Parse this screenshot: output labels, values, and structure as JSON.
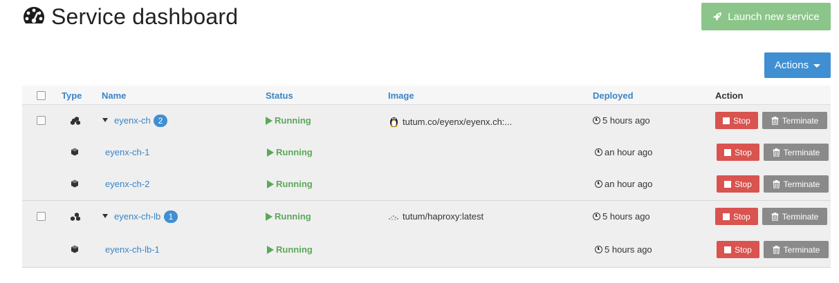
{
  "page": {
    "title": "Service dashboard",
    "launch_label": "Launch new service",
    "actions_label": "Actions"
  },
  "columns": {
    "type": "Type",
    "name": "Name",
    "status": "Status",
    "image": "Image",
    "deployed": "Deployed",
    "action": "Action"
  },
  "groups": [
    {
      "service": {
        "name": "eyenx-ch",
        "badge": "2",
        "status": "Running",
        "image": "tutum.co/eyenx/eyenx.ch:...",
        "image_icon": "linux-tux-icon",
        "deployed": "5 hours ago",
        "stop_label": "Stop",
        "terminate_label": "Terminate"
      },
      "containers": [
        {
          "name": "eyenx-ch-1",
          "status": "Running",
          "deployed": "an hour ago",
          "stop_label": "Stop",
          "terminate_label": "Terminate"
        },
        {
          "name": "eyenx-ch-2",
          "status": "Running",
          "deployed": "an hour ago",
          "stop_label": "Stop",
          "terminate_label": "Terminate"
        }
      ]
    },
    {
      "service": {
        "name": "eyenx-ch-lb",
        "badge": "1",
        "status": "Running",
        "image": "tutum/haproxy:latest",
        "image_icon": "haproxy-dots-icon",
        "deployed": "5 hours ago",
        "stop_label": "Stop",
        "terminate_label": "Terminate"
      },
      "containers": [
        {
          "name": "eyenx-ch-lb-1",
          "status": "Running",
          "deployed": "5 hours ago",
          "stop_label": "Stop",
          "terminate_label": "Terminate"
        }
      ]
    }
  ],
  "colors": {
    "launch_button": "#8bc589",
    "actions_button": "#3f8fd2",
    "link": "#3a84c5",
    "running": "#5ba85a",
    "stop_button": "#d9534f",
    "terminate_button": "#8a8a8a"
  }
}
